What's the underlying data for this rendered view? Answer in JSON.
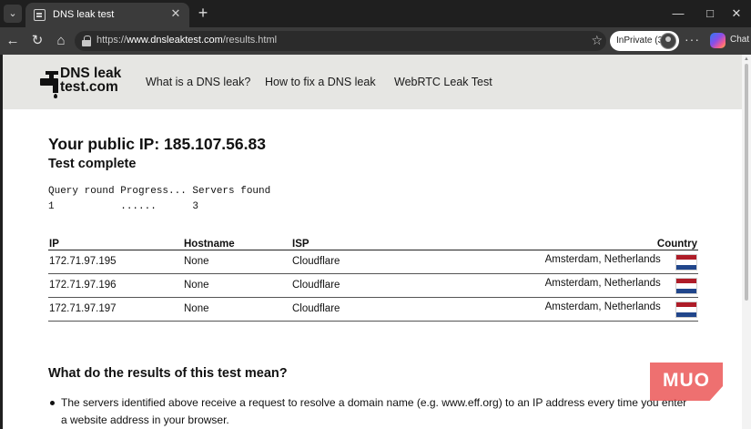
{
  "browser": {
    "tab_title": "DNS leak test",
    "url_prefix": "https://",
    "url_domain": "www.dnsleaktest.com",
    "url_path": "/results.html",
    "inprivate_label": "InPrivate (3)",
    "chat_label": "Chat",
    "icons": {
      "tab_menu": "chevron-down-icon",
      "new_tab": "plus-icon",
      "back": "back-arrow-icon",
      "refresh": "refresh-icon",
      "home": "home-icon",
      "favorite": "star-icon",
      "more": "more-icon"
    }
  },
  "site": {
    "logo_line1": "DNS leak",
    "logo_line2": "test.com",
    "nav": [
      {
        "label": "What is a DNS leak?"
      },
      {
        "label": "How to fix a DNS leak"
      },
      {
        "label": "WebRTC Leak Test"
      }
    ]
  },
  "main": {
    "public_ip_heading": "Your public IP: 185.107.56.83",
    "status_heading": "Test complete",
    "progress_header": "Query round Progress... Servers found",
    "progress_row": "1           ......      3",
    "table": {
      "headers": {
        "ip": "IP",
        "hostname": "Hostname",
        "isp": "ISP",
        "country": "Country"
      },
      "rows": [
        {
          "ip": "172.71.97.195",
          "hostname": "None",
          "isp": "Cloudflare",
          "country": "Amsterdam, Netherlands"
        },
        {
          "ip": "172.71.97.196",
          "hostname": "None",
          "isp": "Cloudflare",
          "country": "Amsterdam, Netherlands"
        },
        {
          "ip": "172.71.97.197",
          "hostname": "None",
          "isp": "Cloudflare",
          "country": "Amsterdam, Netherlands"
        }
      ],
      "flag_colors": [
        "#ae1c28",
        "#ffffff",
        "#21468b"
      ]
    },
    "meaning_heading": "What do the results of this test mean?",
    "bullet_text": "The servers identified above receive a request to resolve a domain name (e.g. www.eff.org) to an IP address every time you enter a website address in your browser."
  },
  "watermark": "MUO"
}
